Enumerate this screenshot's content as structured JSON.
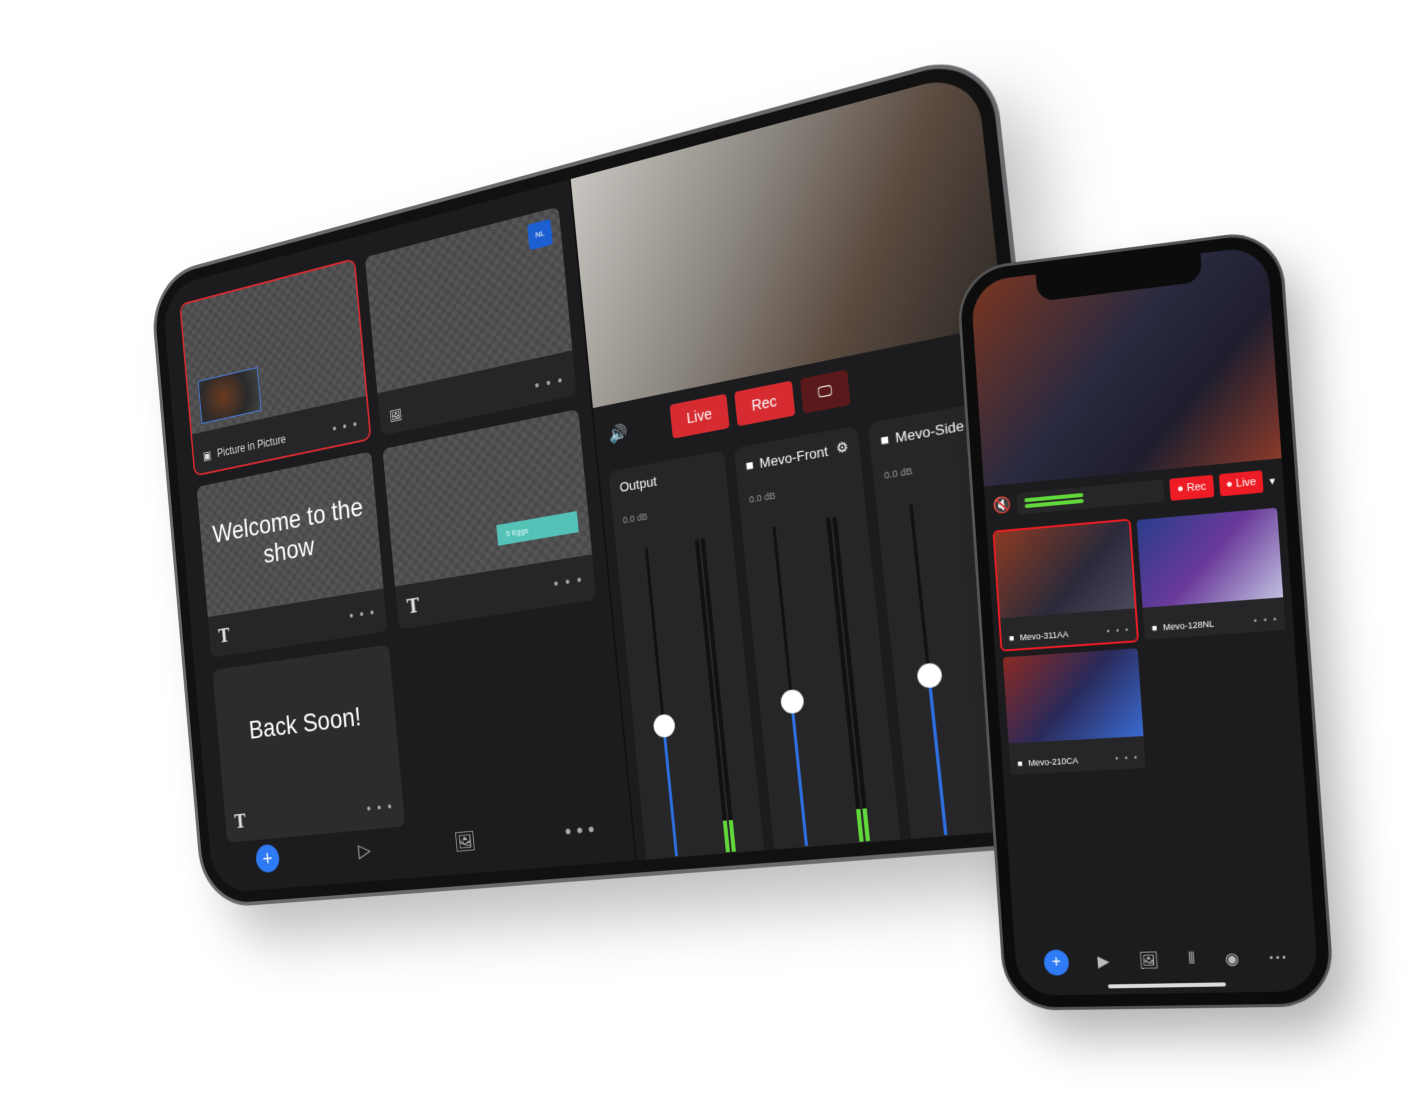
{
  "tablet": {
    "scenes": [
      {
        "label": "Picture in Picture",
        "type": "pip",
        "icon": "pip-icon"
      },
      {
        "label": "",
        "type": "image",
        "icon": "image-icon",
        "logo_text": "NL"
      },
      {
        "text": "Welcome to the show",
        "type": "text",
        "icon": "text-icon"
      },
      {
        "badge_text": "5 Eggs",
        "type": "text",
        "icon": "text-icon"
      },
      {
        "text": "Back Soon!",
        "type": "text",
        "icon": "text-icon"
      }
    ],
    "more_label": "• • •",
    "bottom_bar": {
      "add": "+",
      "media": "▷",
      "image": "🖼",
      "more": "• • •"
    },
    "controls": {
      "live": "Live",
      "rec": "Rec",
      "screen": "🖵",
      "dropdown": "▾",
      "speaker": "🔊"
    },
    "mixer": [
      {
        "name": "Output",
        "db": "0.0 dB",
        "level": 0.42,
        "meter": 0.1
      },
      {
        "name": "Mevo-Front",
        "db": "0.0 dB",
        "level": 0.45,
        "meter": 0.1,
        "gear": "⚙"
      },
      {
        "name": "Mevo-Side",
        "db": "0.0 dB",
        "level": 0.48,
        "meter": 0
      }
    ],
    "mute_icon": "🔊"
  },
  "phone": {
    "rec": "● Rec",
    "live": "● Live",
    "dropdown": "▾",
    "mute_icon": "speaker-muted-icon",
    "cameras": [
      {
        "name": "Mevo-311AA",
        "selected": true
      },
      {
        "name": "Mevo-128NL",
        "selected": false
      },
      {
        "name": "Mevo-210CA",
        "selected": false
      }
    ],
    "more_label": "• • •",
    "bottom_bar": {
      "add": "+",
      "more": "• • •"
    },
    "colors": {
      "accent": "#2f7bf5",
      "live": "#ee1c24",
      "meter": "#62d93a"
    }
  }
}
